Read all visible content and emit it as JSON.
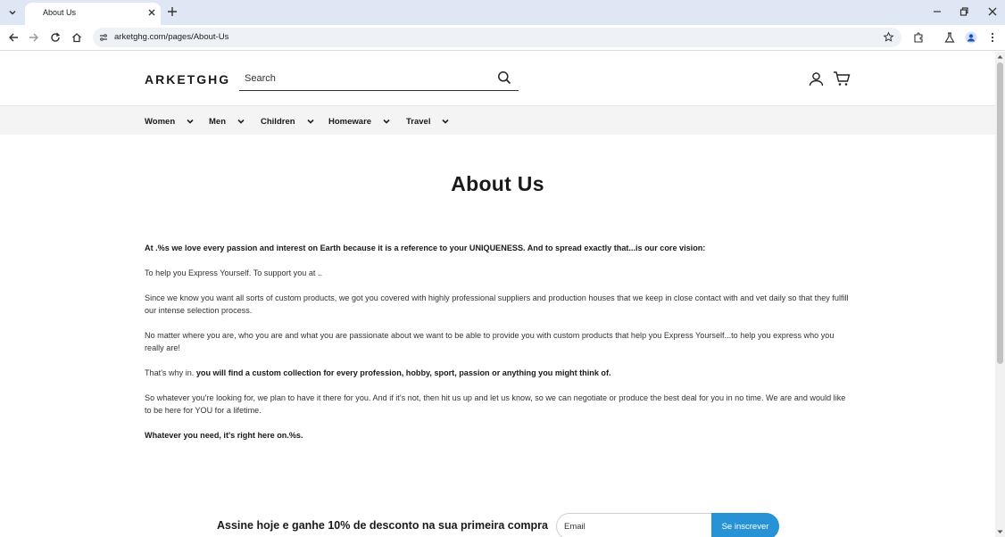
{
  "browser": {
    "tab_title": "About Us",
    "url": "arketghg.com/pages/About-Us"
  },
  "header": {
    "logo": "ARKETGHG",
    "search_placeholder": "Search"
  },
  "nav": {
    "items": [
      {
        "label": "Women"
      },
      {
        "label": "Men"
      },
      {
        "label": "Children"
      },
      {
        "label": "Homeware"
      },
      {
        "label": "Travel"
      }
    ]
  },
  "page": {
    "title": "About Us",
    "paragraphs": {
      "p1": "At .%s we love every passion and interest on Earth because it is a reference to your UNIQUENESS. And to spread exactly that...is our core vision:",
      "p2": "To help you Express Yourself. To support you at ..",
      "p3": "Since we know you want all sorts of custom products, we got you covered with highly professional suppliers and production houses that we keep in close contact with and vet daily so that they fulfill our intense selection process.",
      "p4": "No matter where you are, who you are and what you are passionate about we want to be able to provide you with custom products that help you Express Yourself...to help you express who you really are!",
      "p5_lead": "That's why in. ",
      "p5_bold": "you will find a custom collection for every profession, hobby, sport, passion or anything you might think of.",
      "p6": "So whatever you're looking for, we plan to have it there for you. And if it's not, then hit us up and let us know, so we can negotiate or produce the best deal for you in no time. We are and would like to be here for YOU for a lifetime.",
      "p7": "Whatever you need, it's right here on.%s."
    }
  },
  "newsletter": {
    "title": "Assine hoje e ganhe 10% de desconto na sua primeira compra",
    "email_placeholder": "Email",
    "button_label": "Se inscrever"
  },
  "colors": {
    "accent": "#2793d6",
    "tabbar": "#dfe7f5",
    "nav_bg": "#f4f4f4"
  }
}
